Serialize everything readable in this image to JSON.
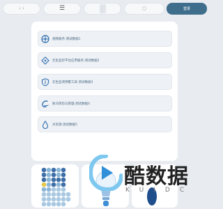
{
  "topbar": {
    "back_icon": "back-icon",
    "menu_icon": "menu-icon",
    "search_icon": "search-icon",
    "primary_label": "登录"
  },
  "list": {
    "items": [
      {
        "label": "视频服务-测试数据1",
        "icon": "water-wheel-icon"
      },
      {
        "label": "云生监控平台应用服务-测试数据2",
        "icon": "hand-tag-icon"
      },
      {
        "label": "云生监测预警工具-测试数据3",
        "icon": "shield-icon"
      },
      {
        "label": "防汛风险与管理-测试数据4",
        "icon": "wave-icon"
      },
      {
        "label": "水资源-测试数据5",
        "icon": "water-drop-icon"
      }
    ]
  },
  "cards": {
    "chart_icon": "dot-matrix-chart-icon",
    "bulb_icon": "light-bulb-icon"
  },
  "colors": {
    "accent": "#3f6e8c",
    "icon_blue": "#2f6fb0",
    "label": "#4a6a86"
  }
}
